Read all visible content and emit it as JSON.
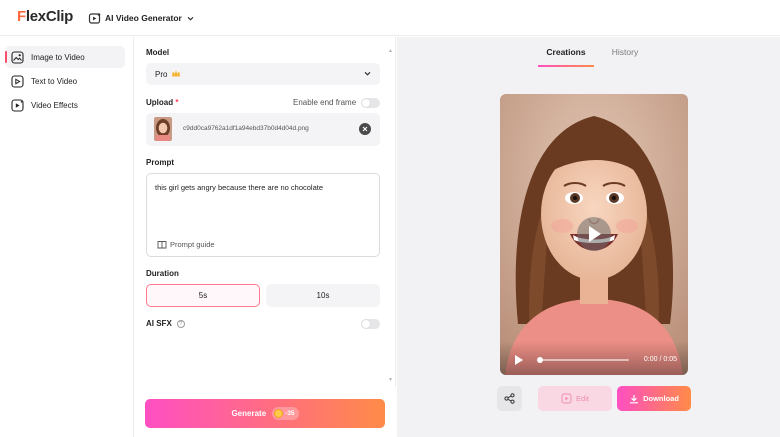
{
  "header": {
    "logo_text": "FlexClip",
    "app_switch_label": "AI Video Generator"
  },
  "sidebar": {
    "items": [
      {
        "label": "Image to Video",
        "icon": "image-video-icon",
        "active": true
      },
      {
        "label": "Text to Video",
        "icon": "text-video-icon",
        "active": false
      },
      {
        "label": "Video Effects",
        "icon": "video-effects-icon",
        "active": false
      }
    ]
  },
  "form": {
    "model_label": "Model",
    "model_value": "Pro",
    "upload_label": "Upload",
    "upload_required_mark": "*",
    "end_frame_label": "Enable end frame",
    "end_frame_on": false,
    "file_name": "c9dd0ca9762a1df1a94ebd37b0d4d04d.png",
    "prompt_label": "Prompt",
    "prompt_text": "this girl gets angry because there are no chocolate",
    "prompt_guide_label": "Prompt guide",
    "duration_label": "Duration",
    "duration_options": [
      "5s",
      "10s"
    ],
    "duration_selected": "5s",
    "sfx_label": "AI SFX",
    "sfx_help": "?",
    "sfx_on": false,
    "generate_label": "Generate",
    "generate_cost": "-35"
  },
  "preview": {
    "tabs": [
      "Creations",
      "History"
    ],
    "active_tab": "Creations",
    "time_text": "0:00 / 0:05",
    "progress": 0,
    "edit_label": "Edit",
    "download_label": "Download"
  },
  "colors": {
    "accent_pink": "#ff4fc3",
    "accent_orange": "#ff8b48",
    "selected_border": "#ff7a8f"
  }
}
